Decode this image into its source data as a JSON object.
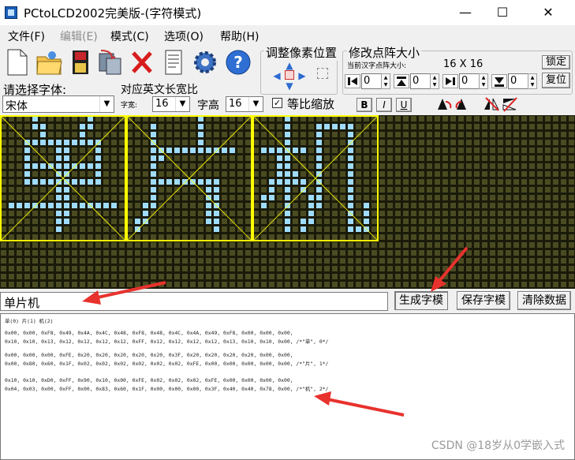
{
  "window": {
    "title": "PCtoLCD2002完美版-(字符模式)"
  },
  "menu": [
    "文件(F)",
    "编辑(E)",
    "模式(C)",
    "选项(O)",
    "帮助(H)"
  ],
  "toolbar_icons": [
    "new-file-icon",
    "open-folder-icon",
    "save-icon",
    "save-as-icon",
    "delete-icon",
    "notes-icon",
    "settings-gear-icon",
    "help-icon"
  ],
  "adjust_group": {
    "label": "调整像素位置"
  },
  "matrix_group": {
    "label": "修改点阵大小",
    "current_label": "当前汉字点阵大小:",
    "size_text": "16 X 16",
    "lock_label": "锁定",
    "reset_label": "复位",
    "spins": [
      "0",
      "0",
      "0",
      "0"
    ]
  },
  "font": {
    "label": "请选择字体:",
    "value": "宋体"
  },
  "en_width": {
    "label": "对应英文长宽比",
    "width_label": "字宽:",
    "width_value": "16",
    "height_label": "字高",
    "height_value": "16"
  },
  "proportional": {
    "label": "等比缩放",
    "checked": true
  },
  "style_buttons": [
    "B",
    "I",
    "U"
  ],
  "preview": {
    "characters": [
      "单",
      "片",
      "机"
    ],
    "lit_color": "#9fdcff",
    "dark_color": "#1a1a0a",
    "dot_color": "#4b4b22",
    "frame_color": "#ffff00"
  },
  "input": {
    "value": "单片机"
  },
  "buttons": {
    "generate": "生成字模",
    "save": "保存字模",
    "clear": "清除数据"
  },
  "output": {
    "header": "单(0) 片(1) 机(2)",
    "lines": [
      "0x00, 0x00, 0xF8, 0x49, 0x4A, 0x4C, 0x48, 0xF8, 0x48, 0x4C, 0x4A, 0x49, 0xF8, 0x00, 0x00, 0x00,",
      "0x10, 0x10, 0x13, 0x12, 0x12, 0x12, 0x12, 0xFF, 0x12, 0x12, 0x12, 0x12, 0x13, 0x10, 0x10, 0x00, /*\"单\", 0*/",
      "",
      "0x00, 0x00, 0x00, 0xFE, 0x20, 0x20, 0x20, 0x20, 0x20, 0x3F, 0x20, 0x20, 0x20, 0x20, 0x00, 0x00,",
      "0x00, 0x80, 0x60, 0x1F, 0x02, 0x02, 0x02, 0x02, 0x02, 0x02, 0xFE, 0x00, 0x00, 0x00, 0x00, 0x00, /*\"片\", 1*/",
      "",
      "0x10, 0x10, 0xD0, 0xFF, 0x90, 0x10, 0x00, 0xFE, 0x02, 0x02, 0x02, 0xFE, 0x00, 0x00, 0x00, 0x00,",
      "0x04, 0x03, 0x00, 0xFF, 0x00, 0x83, 0x60, 0x1F, 0x00, 0x00, 0x00, 0x3F, 0x40, 0x40, 0x78, 0x00, /*\"机\", 2*/"
    ],
    "watermark": "CSDN @18岁从0学嵌入式"
  },
  "annotation_color": "#e8322d"
}
